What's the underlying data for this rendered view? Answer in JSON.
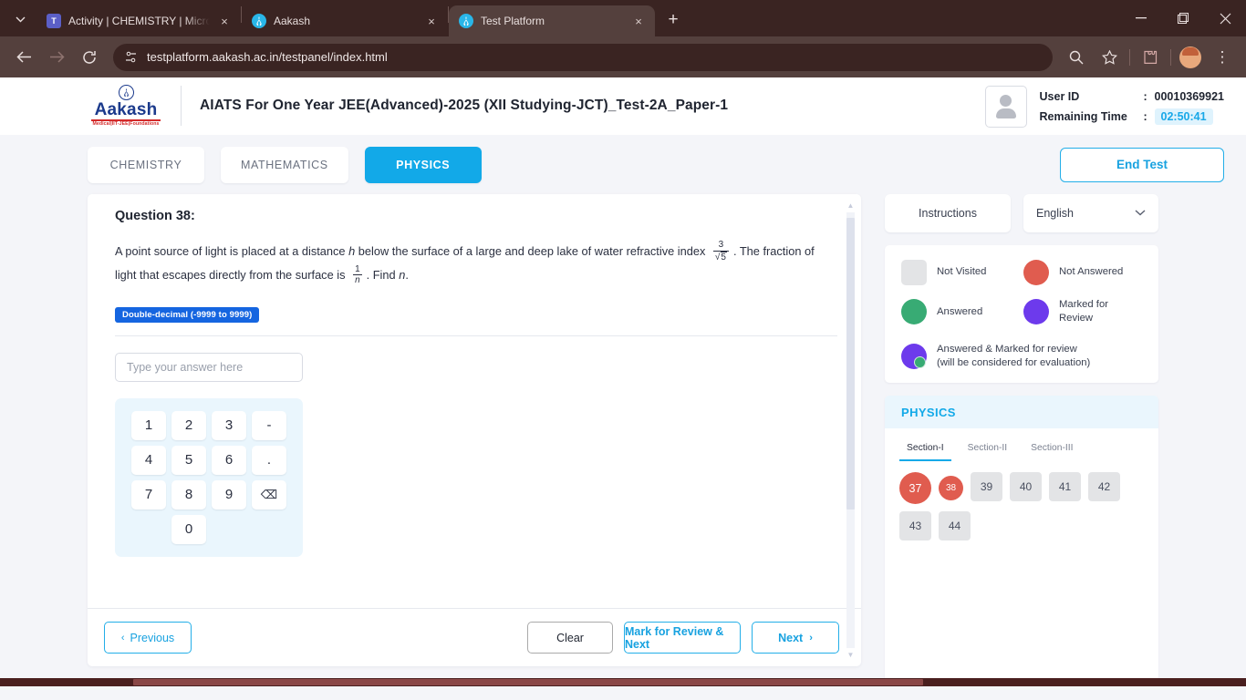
{
  "browser": {
    "tabs": [
      {
        "title": "Activity | CHEMISTRY | Microsof",
        "favicon": "teams-icon",
        "active": false
      },
      {
        "title": "Aakash",
        "favicon": "aakash-icon",
        "active": false
      },
      {
        "title": "Test Platform",
        "favicon": "aakash-icon",
        "active": true
      }
    ],
    "url": "testplatform.aakash.ac.in/testpanel/index.html",
    "new_tab_label": "+",
    "close_label": "×",
    "window": {
      "minimize": "—",
      "maximize": "❐",
      "close": "✕"
    },
    "toolbar": {
      "back": "←",
      "forward": "→",
      "reload": "⟳",
      "site_info": "site-settings-icon",
      "zoom": "search-icon",
      "bookmark": "☆",
      "extensions": "extensions-icon",
      "menu": "⋮"
    }
  },
  "header": {
    "logo": {
      "name": "Aakash",
      "tagline": "Medical|IIT-JEE|Foundations"
    },
    "test_title": "AIATS For One Year JEE(Advanced)-2025 (XII Studying-JCT)_Test-2A_Paper-1",
    "user_id_label": "User ID",
    "user_id_value": "00010369921",
    "remaining_time_label": "Remaining Time",
    "remaining_time_value": "02:50:41",
    "colon": ":"
  },
  "subjects": {
    "tabs": [
      {
        "label": "CHEMISTRY",
        "active": false
      },
      {
        "label": "MATHEMATICS",
        "active": false
      },
      {
        "label": "PHYSICS",
        "active": true
      }
    ],
    "end_test_label": "End Test"
  },
  "question": {
    "title": "Question 38:",
    "text_part1": "A point source of light is placed at a distance ",
    "var_h": "h",
    "text_part2": " below the surface of a large and deep lake of water refractive index ",
    "frac1_num": "3",
    "frac1_den_radical": "√",
    "frac1_den": "5",
    "text_part3": ". The fraction of light that escapes directly from the surface is ",
    "frac2_num": "1",
    "frac2_den": "n",
    "text_part4": ". Find ",
    "var_n": "n",
    "text_part5": ".",
    "type_badge": "Double-decimal (-9999 to 9999)",
    "answer_value": "",
    "answer_placeholder": "Type your answer here",
    "keypad": [
      "1",
      "2",
      "3",
      "-",
      "4",
      "5",
      "6",
      ".",
      "7",
      "8",
      "9",
      "⌫",
      "0"
    ]
  },
  "footer": {
    "previous_label": "Previous",
    "clear_label": "Clear",
    "mark_review_label": "Mark for Review & Next",
    "next_label": "Next",
    "prev_chevron": "‹",
    "next_chevron": "›"
  },
  "sidebar": {
    "instructions_label": "Instructions",
    "language_value": "English",
    "language_chevron": "⌄",
    "legend": [
      {
        "state": "not-visited",
        "label": "Not Visited",
        "color": "#e3e4e6"
      },
      {
        "state": "not-answered",
        "label": "Not Answered",
        "color": "#e05c4f"
      },
      {
        "state": "answered",
        "label": "Answered",
        "color": "#38ab74"
      },
      {
        "state": "marked-for-review",
        "label": "Marked for Review",
        "color": "#6d3aec"
      },
      {
        "state": "answered-and-marked",
        "label": "Answered & Marked for review (will be considered for evaluation)",
        "line1": "Answered & Marked for review",
        "line2": "(will be considered for evaluation)",
        "color": "#6d3aec"
      }
    ],
    "section_title": "PHYSICS",
    "section_tabs": [
      {
        "label": "Section-I",
        "active": true
      },
      {
        "label": "Section-II",
        "active": false
      },
      {
        "label": "Section-III",
        "active": false
      }
    ],
    "questions": [
      {
        "number": "37",
        "state": "current-not-answered"
      },
      {
        "number": "38",
        "state": "not-answered"
      },
      {
        "number": "39",
        "state": "not-visited"
      },
      {
        "number": "40",
        "state": "not-visited"
      },
      {
        "number": "41",
        "state": "not-visited"
      },
      {
        "number": "42",
        "state": "not-visited"
      },
      {
        "number": "43",
        "state": "not-visited"
      },
      {
        "number": "44",
        "state": "not-visited"
      }
    ]
  }
}
